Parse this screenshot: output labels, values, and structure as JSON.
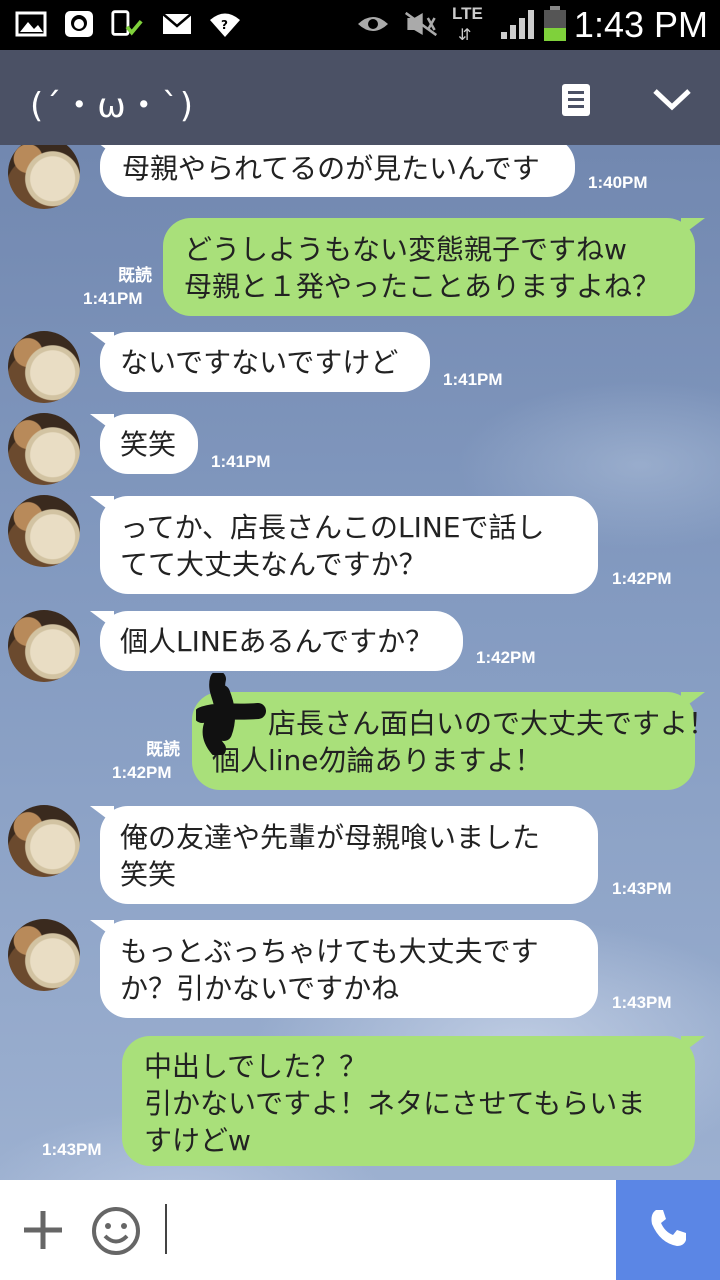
{
  "status_bar": {
    "time": "1:43 PM",
    "network": "LTE",
    "icons": [
      "image-icon",
      "app-icon",
      "sim-check-icon",
      "mail-icon",
      "wifi-question-icon",
      "eye-icon",
      "mute-icon",
      "signal-icon",
      "battery-icon"
    ]
  },
  "header": {
    "title": "(´・ω・`)",
    "icons": [
      "notes-icon",
      "chevron-down-icon"
    ]
  },
  "messages": [
    {
      "side": "in",
      "text": "母親やられてるのが見たいんです",
      "time": "1:40PM"
    },
    {
      "side": "out",
      "text": "どうしようもない変態親子ですねw\n母親と１発やったことありますよね？",
      "read": "既読",
      "time": "1:41PM"
    },
    {
      "side": "in",
      "text": "ないですないですけど",
      "time": "1:41PM"
    },
    {
      "side": "in",
      "text": "笑笑",
      "time": "1:41PM"
    },
    {
      "side": "in",
      "text": "ってか、店長さんこのLINEで話し\nてて大丈夫なんですか？",
      "time": "1:42PM"
    },
    {
      "side": "in",
      "text": "個人LINEあるんですか？",
      "time": "1:42PM"
    },
    {
      "side": "out",
      "text": "　　店長さん面白いので大丈夫ですよ！\n個人line勿論ありますよ！",
      "read": "既読",
      "time": "1:42PM"
    },
    {
      "side": "in",
      "text": "俺の友達や先輩が母親喰いました\n笑笑",
      "time": "1:43PM"
    },
    {
      "side": "in",
      "text": "もっとぶっちゃけても大丈夫です\nか？引かないですかね",
      "time": "1:43PM"
    },
    {
      "side": "out",
      "text": "中出しでした？？\n引かないですよ！ネタにさせてもらいま\nすけどw",
      "time": "1:43PM"
    }
  ],
  "footer": {
    "icons": [
      "plus-icon",
      "emoji-icon",
      "phone-icon"
    ]
  },
  "colors": {
    "header_bg": "#4b5165",
    "incoming_bubble": "#ffffff",
    "outgoing_bubble": "#a9e07a",
    "call_button": "#5b86e5"
  }
}
